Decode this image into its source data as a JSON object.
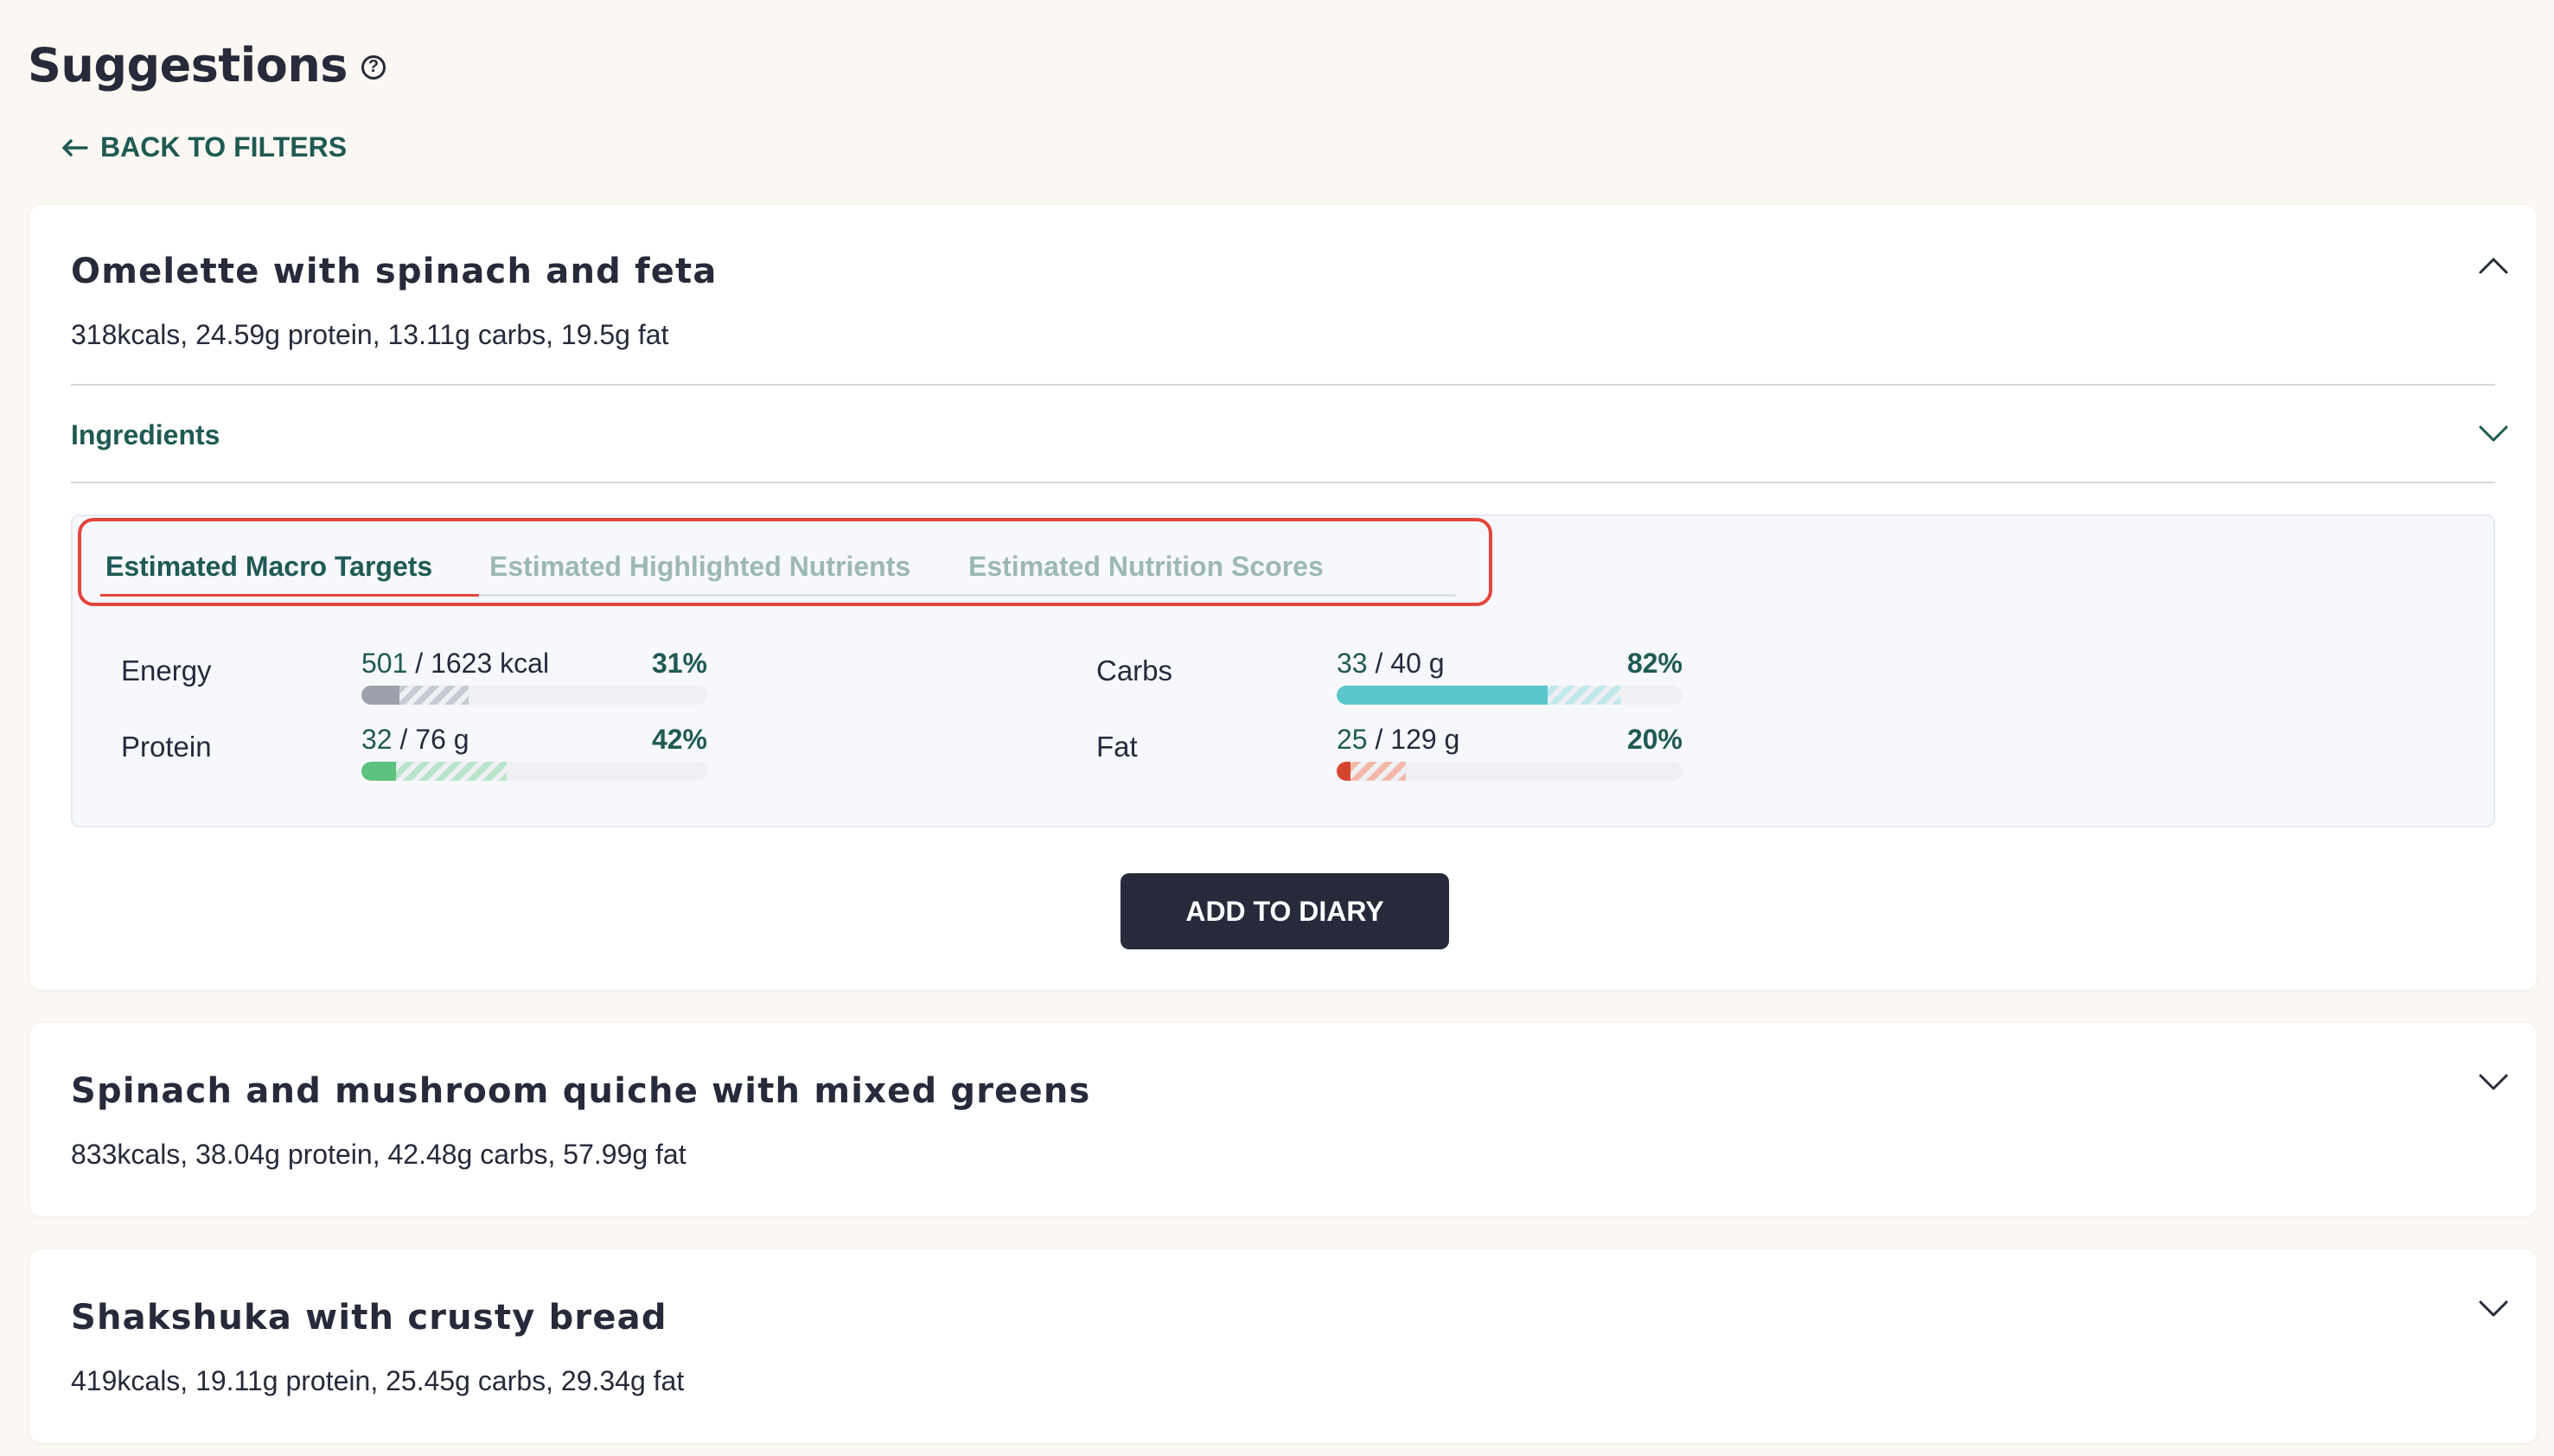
{
  "page": {
    "title": "Suggestions",
    "help_icon": "question-circle-icon",
    "back_label": "BACK TO FILTERS",
    "back_icon": "arrow-left-icon"
  },
  "suggestions": [
    {
      "title": "Omelette with spinach and feta",
      "summary": "318kcals, 24.59g protein, 13.11g carbs, 19.5g fat",
      "expanded": true,
      "ingredients_label": "Ingredients",
      "tabs": [
        {
          "label": "Estimated Macro Targets",
          "active": true
        },
        {
          "label": "Estimated Highlighted Nutrients",
          "active": false
        },
        {
          "label": "Estimated Nutrition Scores",
          "active": false
        }
      ],
      "macros": {
        "energy": {
          "label": "Energy",
          "current": "501",
          "target": "/ 1623 kcal",
          "pct": "31%",
          "fill": 0.11,
          "projected": 0.31,
          "color": "#9ca0ab",
          "hatch": "#c8cbd3"
        },
        "protein": {
          "label": "Protein",
          "current": "32",
          "target": "/ 76 g",
          "pct": "42%",
          "fill": 0.1,
          "projected": 0.42,
          "color": "#5cc27e",
          "hatch": "#b9e6c8"
        },
        "carbs": {
          "label": "Carbs",
          "current": "33",
          "target": "/ 40 g",
          "pct": "82%",
          "fill": 0.61,
          "projected": 0.82,
          "color": "#5bc7cd",
          "hatch": "#bfe9ec"
        },
        "fat": {
          "label": "Fat",
          "current": "25",
          "target": "/ 129 g",
          "pct": "20%",
          "fill": 0.04,
          "projected": 0.2,
          "color": "#d6462f",
          "hatch": "#f4b8ab"
        }
      },
      "add_label": "ADD TO DIARY"
    },
    {
      "title": "Spinach and mushroom quiche with mixed greens",
      "summary": "833kcals, 38.04g protein, 42.48g carbs, 57.99g fat",
      "expanded": false
    },
    {
      "title": "Shakshuka with crusty bread",
      "summary": "419kcals, 19.11g protein, 25.45g carbs, 29.34g fat",
      "expanded": false
    }
  ]
}
